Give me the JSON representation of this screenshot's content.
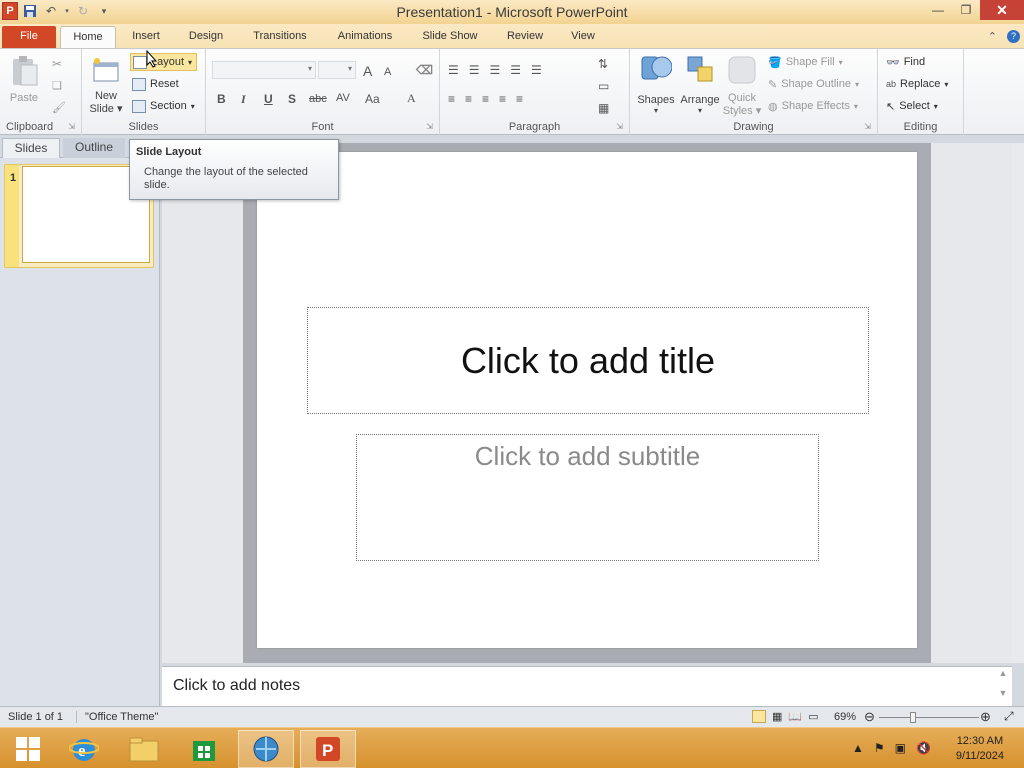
{
  "window": {
    "title": "Presentation1  -  Microsoft PowerPoint"
  },
  "tabs": [
    "File",
    "Home",
    "Insert",
    "Design",
    "Transitions",
    "Animations",
    "Slide Show",
    "Review",
    "View"
  ],
  "ribbon": {
    "clipboard": {
      "paste": "Paste",
      "label": "Clipboard"
    },
    "slides": {
      "new_slide_line1": "New",
      "new_slide_line2": "Slide",
      "layout": "Layout",
      "reset": "Reset",
      "section": "Section",
      "label": "Slides"
    },
    "font": {
      "grow": "A",
      "shrink": "A",
      "bold": "B",
      "italic": "I",
      "underline": "U",
      "shadow": "S",
      "strike": "abc",
      "spacing": "AV",
      "case": "Aa",
      "color": "A",
      "label": "Font"
    },
    "paragraph": {
      "label": "Paragraph"
    },
    "drawing": {
      "shapes": "Shapes",
      "arrange": "Arrange",
      "quick_styles_1": "Quick",
      "quick_styles_2": "Styles",
      "shape_fill": "Shape Fill",
      "shape_outline": "Shape Outline",
      "shape_effects": "Shape Effects",
      "label": "Drawing"
    },
    "editing": {
      "find": "Find",
      "replace": "Replace",
      "select": "Select",
      "label": "Editing"
    }
  },
  "left_pane": {
    "tabs": [
      "Slides",
      "Outline"
    ],
    "slide_number": "1"
  },
  "tooltip": {
    "title": "Slide Layout",
    "description": "Change the layout of the selected slide."
  },
  "slide": {
    "title_placeholder": "Click to add title",
    "subtitle_placeholder": "Click to add subtitle"
  },
  "notes": {
    "placeholder": "Click to add notes"
  },
  "status": {
    "slide_info": "Slide 1 of 1",
    "theme": "\"Office Theme\"",
    "zoom": "69%"
  },
  "clock": {
    "time": "12:30 AM",
    "date": "9/11/2024"
  },
  "colors": {
    "file_tab": "#d24726",
    "accent": "#f2d391",
    "taskbar": "#d6912d"
  }
}
